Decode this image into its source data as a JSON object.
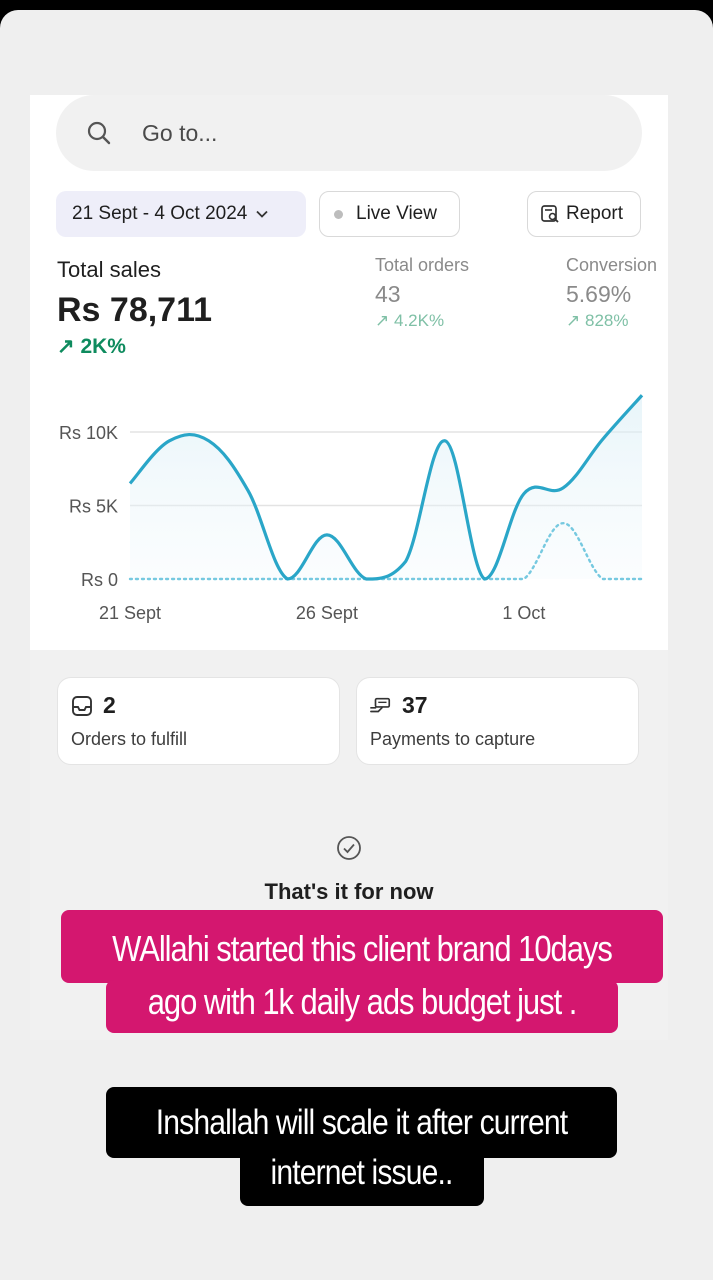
{
  "search": {
    "placeholder": "Go to..."
  },
  "toolbar": {
    "date_range": "21 Sept - 4 Oct 2024",
    "live_view": "Live View",
    "report": "Report"
  },
  "metrics": {
    "total_sales": {
      "label": "Total sales",
      "value": "Rs 78,711",
      "change": "2K%"
    },
    "total_orders": {
      "label": "Total orders",
      "value": "43",
      "change": "4.2K%"
    },
    "conversion": {
      "label": "Conversion",
      "value": "5.69%",
      "change": "828%"
    }
  },
  "chart_data": {
    "type": "line",
    "y_ticks": [
      "Rs 10K",
      "Rs 5K",
      "Rs 0"
    ],
    "x_ticks": [
      "21 Sept",
      "26 Sept",
      "1 Oct"
    ],
    "ylim": [
      0,
      13000
    ],
    "grid": true,
    "colors": {
      "current": "#2aa6c8",
      "comparison": "#76c9e0"
    },
    "series": [
      {
        "style": "solid",
        "x": [
          0,
          1,
          2,
          3,
          4,
          5,
          6,
          7,
          8,
          9,
          10,
          11,
          12,
          13
        ],
        "values": [
          6500,
          9400,
          9400,
          6000,
          0,
          3000,
          0,
          1200,
          9400,
          0,
          5800,
          6200,
          9500,
          12500
        ]
      },
      {
        "style": "dotted",
        "x": [
          0,
          1,
          2,
          3,
          4,
          5,
          6,
          7,
          8,
          9,
          10,
          11,
          12,
          13
        ],
        "values": [
          0,
          0,
          0,
          0,
          0,
          0,
          0,
          0,
          0,
          0,
          0,
          3800,
          0,
          0
        ]
      }
    ]
  },
  "tiles": [
    {
      "count": "2",
      "label": "Orders to fulfill"
    },
    {
      "count": "37",
      "label": "Payments to capture"
    }
  ],
  "empty_state": {
    "text": "That's it for now"
  },
  "captions": {
    "first": "WAllahi started this client brand 10days ago  with 1k daily ads budget just .",
    "second": "Inshallah will scale it after current internet issue.."
  }
}
